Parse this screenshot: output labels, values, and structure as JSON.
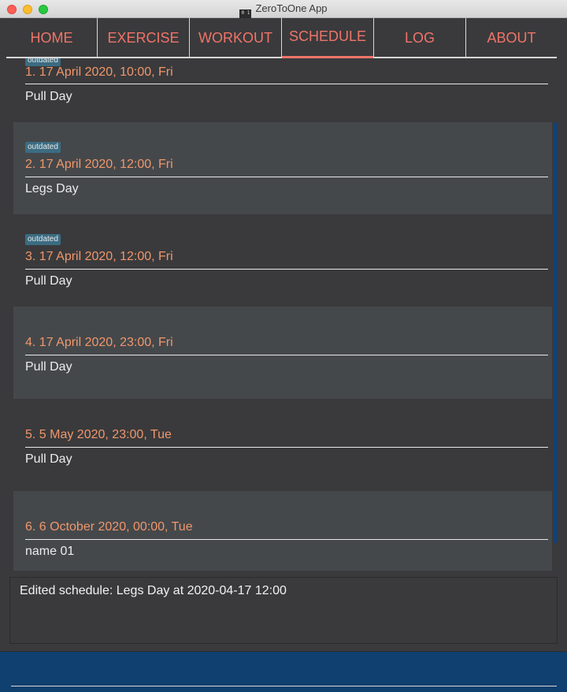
{
  "window": {
    "title": "ZeroToOne App",
    "icon_text": "0 1"
  },
  "tabs": [
    {
      "label": "HOME"
    },
    {
      "label": "EXERCISE"
    },
    {
      "label": "WORKOUT"
    },
    {
      "label": "SCHEDULE"
    },
    {
      "label": "LOG"
    },
    {
      "label": "ABOUT"
    }
  ],
  "active_tab": "SCHEDULE",
  "schedules": [
    {
      "title": "1.  17 April 2020, 10:00, Fri",
      "name": "Pull Day",
      "badge": "outdated"
    },
    {
      "title": "2.  17 April 2020, 12:00, Fri",
      "name": "Legs Day",
      "badge": "outdated"
    },
    {
      "title": "3.  17 April 2020, 12:00, Fri",
      "name": "Pull Day",
      "badge": "outdated"
    },
    {
      "title": "4.  17 April 2020, 23:00, Fri",
      "name": "Pull Day",
      "badge": ""
    },
    {
      "title": "5.  5 May 2020, 23:00, Tue",
      "name": "Pull Day",
      "badge": ""
    },
    {
      "title": "6.  6 October 2020, 00:00, Tue",
      "name": "name 01",
      "badge": ""
    }
  ],
  "result": {
    "text": "Edited schedule: Legs Day at 2020-04-17 12:00"
  },
  "command": {
    "value": "",
    "placeholder": ""
  },
  "colors": {
    "accent": "#f07468",
    "card_title": "#f0976b",
    "badge_bg": "#3b6c82",
    "command_bar": "#10406f",
    "background": "#3a3a3c"
  }
}
